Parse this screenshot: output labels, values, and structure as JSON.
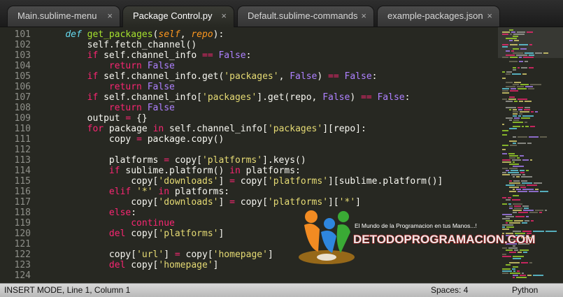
{
  "tabs": [
    {
      "label": "Main.sublime-menu",
      "close": "×",
      "active": false
    },
    {
      "label": "Package Control.py",
      "close": "×",
      "active": true
    },
    {
      "label": "Default.sublime-commands",
      "close": "×",
      "active": false
    },
    {
      "label": "example-packages.json",
      "close": "×",
      "active": false
    }
  ],
  "gutter": [
    "101",
    "102",
    "103",
    "104",
    "105",
    "106",
    "107",
    "108",
    "109",
    "110",
    "111",
    "112",
    "113",
    "114",
    "115",
    "116",
    "117",
    "118",
    "119",
    "120",
    "121",
    "122",
    "123",
    "124"
  ],
  "code_lines": [
    [
      {
        "t": "    ",
        "c": ""
      },
      {
        "t": "def",
        "c": "def"
      },
      {
        "t": " ",
        "c": ""
      },
      {
        "t": "get_packages",
        "c": "fn"
      },
      {
        "t": "(",
        "c": ""
      },
      {
        "t": "self",
        "c": "param"
      },
      {
        "t": ", ",
        "c": ""
      },
      {
        "t": "repo",
        "c": "param"
      },
      {
        "t": "):",
        "c": ""
      }
    ],
    [
      {
        "t": "        self.fetch_channel()",
        "c": ""
      }
    ],
    [
      {
        "t": "        ",
        "c": ""
      },
      {
        "t": "if",
        "c": "kw"
      },
      {
        "t": " self.channel_info ",
        "c": ""
      },
      {
        "t": "==",
        "c": "kw"
      },
      {
        "t": " ",
        "c": ""
      },
      {
        "t": "False",
        "c": "bool"
      },
      {
        "t": ":",
        "c": ""
      }
    ],
    [
      {
        "t": "            ",
        "c": ""
      },
      {
        "t": "return",
        "c": "kw"
      },
      {
        "t": " ",
        "c": ""
      },
      {
        "t": "False",
        "c": "bool"
      }
    ],
    [
      {
        "t": "        ",
        "c": ""
      },
      {
        "t": "if",
        "c": "kw"
      },
      {
        "t": " self.channel_info.get(",
        "c": ""
      },
      {
        "t": "'packages'",
        "c": "str"
      },
      {
        "t": ", ",
        "c": ""
      },
      {
        "t": "False",
        "c": "bool"
      },
      {
        "t": ") ",
        "c": ""
      },
      {
        "t": "==",
        "c": "kw"
      },
      {
        "t": " ",
        "c": ""
      },
      {
        "t": "False",
        "c": "bool"
      },
      {
        "t": ":",
        "c": ""
      }
    ],
    [
      {
        "t": "            ",
        "c": ""
      },
      {
        "t": "return",
        "c": "kw"
      },
      {
        "t": " ",
        "c": ""
      },
      {
        "t": "False",
        "c": "bool"
      }
    ],
    [
      {
        "t": "        ",
        "c": ""
      },
      {
        "t": "if",
        "c": "kw"
      },
      {
        "t": " self.channel_info[",
        "c": ""
      },
      {
        "t": "'packages'",
        "c": "str"
      },
      {
        "t": "].get(repo, ",
        "c": ""
      },
      {
        "t": "False",
        "c": "bool"
      },
      {
        "t": ") ",
        "c": ""
      },
      {
        "t": "==",
        "c": "kw"
      },
      {
        "t": " ",
        "c": ""
      },
      {
        "t": "False",
        "c": "bool"
      },
      {
        "t": ":",
        "c": ""
      }
    ],
    [
      {
        "t": "            ",
        "c": ""
      },
      {
        "t": "return",
        "c": "kw"
      },
      {
        "t": " ",
        "c": ""
      },
      {
        "t": "False",
        "c": "bool"
      }
    ],
    [
      {
        "t": "        output ",
        "c": ""
      },
      {
        "t": "=",
        "c": "kw"
      },
      {
        "t": " {}",
        "c": ""
      }
    ],
    [
      {
        "t": "        ",
        "c": ""
      },
      {
        "t": "for",
        "c": "kw"
      },
      {
        "t": " package ",
        "c": ""
      },
      {
        "t": "in",
        "c": "kw"
      },
      {
        "t": " self.channel_info[",
        "c": ""
      },
      {
        "t": "'packages'",
        "c": "str"
      },
      {
        "t": "][repo]:",
        "c": ""
      }
    ],
    [
      {
        "t": "            copy ",
        "c": ""
      },
      {
        "t": "=",
        "c": "kw"
      },
      {
        "t": " package.copy()",
        "c": ""
      }
    ],
    [
      {
        "t": "",
        "c": ""
      }
    ],
    [
      {
        "t": "            platforms ",
        "c": ""
      },
      {
        "t": "=",
        "c": "kw"
      },
      {
        "t": " copy[",
        "c": ""
      },
      {
        "t": "'platforms'",
        "c": "str"
      },
      {
        "t": "].keys()",
        "c": ""
      }
    ],
    [
      {
        "t": "            ",
        "c": ""
      },
      {
        "t": "if",
        "c": "kw"
      },
      {
        "t": " sublime.platform() ",
        "c": ""
      },
      {
        "t": "in",
        "c": "kw"
      },
      {
        "t": " platforms:",
        "c": ""
      }
    ],
    [
      {
        "t": "                copy[",
        "c": ""
      },
      {
        "t": "'downloads'",
        "c": "str"
      },
      {
        "t": "] ",
        "c": ""
      },
      {
        "t": "=",
        "c": "kw"
      },
      {
        "t": " copy[",
        "c": ""
      },
      {
        "t": "'platforms'",
        "c": "str"
      },
      {
        "t": "][sublime.platform()]",
        "c": ""
      }
    ],
    [
      {
        "t": "            ",
        "c": ""
      },
      {
        "t": "elif",
        "c": "kw"
      },
      {
        "t": " ",
        "c": ""
      },
      {
        "t": "'*'",
        "c": "str"
      },
      {
        "t": " ",
        "c": ""
      },
      {
        "t": "in",
        "c": "kw"
      },
      {
        "t": " platforms:",
        "c": ""
      }
    ],
    [
      {
        "t": "                copy[",
        "c": ""
      },
      {
        "t": "'downloads'",
        "c": "str"
      },
      {
        "t": "] ",
        "c": ""
      },
      {
        "t": "=",
        "c": "kw"
      },
      {
        "t": " copy[",
        "c": ""
      },
      {
        "t": "'platforms'",
        "c": "str"
      },
      {
        "t": "][",
        "c": ""
      },
      {
        "t": "'*'",
        "c": "str"
      },
      {
        "t": "]",
        "c": ""
      }
    ],
    [
      {
        "t": "            ",
        "c": ""
      },
      {
        "t": "else",
        "c": "kw"
      },
      {
        "t": ":",
        "c": ""
      }
    ],
    [
      {
        "t": "                ",
        "c": ""
      },
      {
        "t": "continue",
        "c": "kw"
      }
    ],
    [
      {
        "t": "            ",
        "c": ""
      },
      {
        "t": "del",
        "c": "kw"
      },
      {
        "t": " copy[",
        "c": ""
      },
      {
        "t": "'platforms'",
        "c": "str"
      },
      {
        "t": "]",
        "c": ""
      }
    ],
    [
      {
        "t": "",
        "c": ""
      }
    ],
    [
      {
        "t": "            copy[",
        "c": ""
      },
      {
        "t": "'url'",
        "c": "str"
      },
      {
        "t": "] ",
        "c": ""
      },
      {
        "t": "=",
        "c": "kw"
      },
      {
        "t": " copy[",
        "c": ""
      },
      {
        "t": "'homepage'",
        "c": "str"
      },
      {
        "t": "]",
        "c": ""
      }
    ],
    [
      {
        "t": "            ",
        "c": ""
      },
      {
        "t": "del",
        "c": "kw"
      },
      {
        "t": " copy[",
        "c": ""
      },
      {
        "t": "'homepage'",
        "c": "str"
      },
      {
        "t": "]",
        "c": ""
      }
    ],
    [
      {
        "t": "",
        "c": ""
      }
    ]
  ],
  "statusbar": {
    "mode": "INSERT MODE, Line 1, Column 1",
    "spaces": "Spaces: 4",
    "syntax": "Python"
  },
  "watermark": {
    "tagline": "El Mundo de la Programacion en tus Manos...!",
    "brand": "DETODOPROGRAMACION.COM"
  },
  "colors": {
    "background": "#272822",
    "keyword": "#f92672",
    "function": "#a6e22e",
    "string": "#e6db74",
    "constant": "#ae81ff",
    "parameter": "#fd971f",
    "storage": "#66d9ef"
  },
  "icons": [
    "tab-close-icon",
    "watermark-logo-icon",
    "minimap"
  ]
}
